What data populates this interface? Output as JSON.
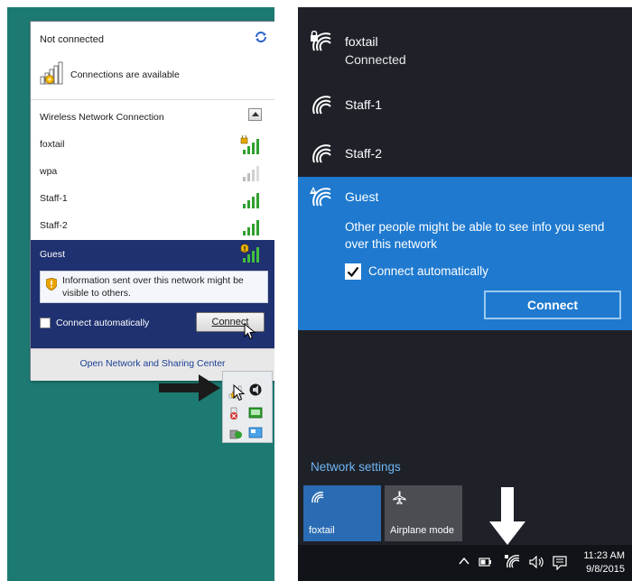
{
  "win7": {
    "status": "Not connected",
    "available": "Connections are available",
    "section_title": "Wireless Network Connection",
    "networks": [
      {
        "name": "foxtail",
        "secured": true,
        "bars": 4
      },
      {
        "name": "wpa",
        "secured": false,
        "bars": 2
      },
      {
        "name": "Staff-1",
        "secured": false,
        "bars": 4
      },
      {
        "name": "Staff-2",
        "secured": false,
        "bars": 4
      }
    ],
    "guest": {
      "name": "Guest",
      "warning": "Information sent over this network might be visible to others.",
      "checkbox_label": "Connect automatically",
      "checkbox_checked": false,
      "connect_label": "Connect"
    },
    "footer_link": "Open Network and Sharing Center",
    "colors": {
      "desktop": "#1d7a72",
      "selected": "#1f3170",
      "link": "#1c3f94"
    }
  },
  "win10": {
    "networks": [
      {
        "name": "foxtail",
        "status": "Connected",
        "secured": true
      },
      {
        "name": "Staff-1",
        "status": "",
        "secured": false
      },
      {
        "name": "Staff-2",
        "status": "",
        "secured": false
      }
    ],
    "guest": {
      "name": "Guest",
      "warning": "Other people might be able to see info you send over this network",
      "checkbox_label": "Connect automatically",
      "checkbox_checked": true,
      "connect_label": "Connect"
    },
    "network_settings": "Network settings",
    "tiles": [
      {
        "label": "foxtail",
        "icon": "wifi-icon",
        "active": true
      },
      {
        "label": "Airplane mode",
        "icon": "airplane-icon",
        "active": false
      }
    ],
    "clock": {
      "time": "11:23 AM",
      "date": "9/8/2015"
    },
    "colors": {
      "background": "#1e2128",
      "accent": "#1e79cf",
      "settings_link": "#6fb6f5"
    }
  }
}
